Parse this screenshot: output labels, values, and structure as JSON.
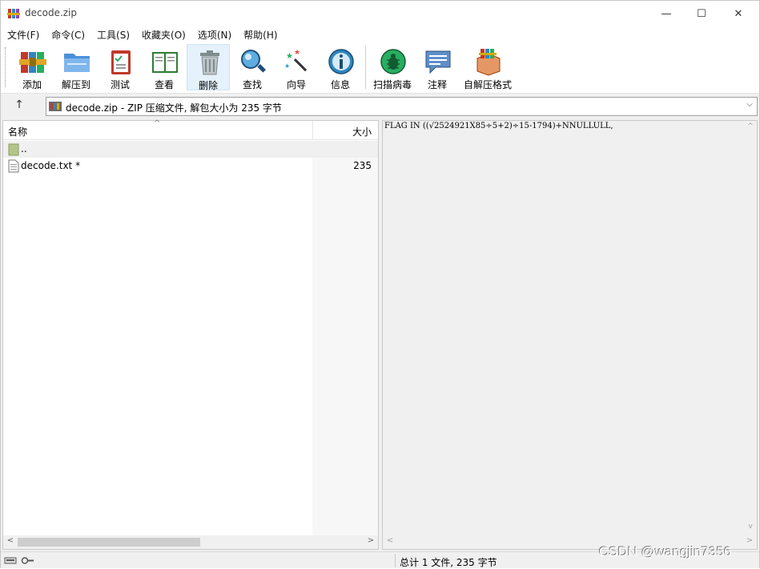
{
  "window": {
    "title": "decode.zip",
    "controls": {
      "minimize": "—",
      "maximize": "☐",
      "close": "✕"
    }
  },
  "menu": [
    "文件(F)",
    "命令(C)",
    "工具(S)",
    "收藏夹(O)",
    "选项(N)",
    "帮助(H)"
  ],
  "toolbar": {
    "add": "添加",
    "extract": "解压到",
    "test": "测试",
    "view": "查看",
    "delete": "删除",
    "find": "查找",
    "wizard": "向导",
    "info": "信息",
    "scan": "扫描病毒",
    "comment": "注释",
    "sfx": "自解压格式"
  },
  "address": {
    "up": "↑",
    "text": "decode.zip - ZIP 压缩文件, 解包大小为 235 字节",
    "dropdown": "⌵"
  },
  "file_list": {
    "columns": {
      "name": "名称",
      "size": "大小"
    },
    "rows": [
      {
        "name": "..",
        "size": ""
      },
      {
        "name": "decode.txt *",
        "size": "235"
      }
    ],
    "scroll": {
      "left": "<",
      "right": ">"
    }
  },
  "preview": {
    "text": "FLAG IN ((√2524921X85÷5+2)÷15-1794)+NNULLULL,",
    "scroll": {
      "up": "^",
      "down": "v",
      "left": "<",
      "right": ">"
    }
  },
  "status": {
    "text": "总计 1 文件, 235 字节"
  },
  "watermark": "CSDN @wangjin7356"
}
